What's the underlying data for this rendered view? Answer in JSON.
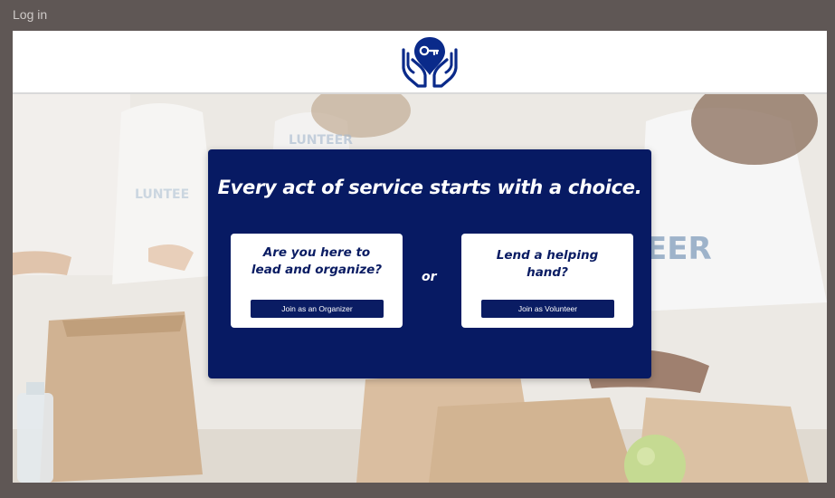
{
  "topbar": {
    "login_label": "Log in"
  },
  "header": {
    "logo_icon": "hands-holding-key-pin-icon",
    "brand_color": "#0a2a8a"
  },
  "hero": {
    "background_image": "volunteers-packing-food-bags-photo"
  },
  "modal": {
    "headline": "Every act of service starts with a choice.",
    "separator": "or",
    "background_color": "#071a63",
    "organizer_card": {
      "question_line1": "Are you here to",
      "question_line2": "lead and organize?",
      "button_label": "Join as an Organizer"
    },
    "volunteer_card": {
      "question_line1": "Lend a helping",
      "question_line2": "hand?",
      "button_label": "Join as Volunteer"
    }
  }
}
